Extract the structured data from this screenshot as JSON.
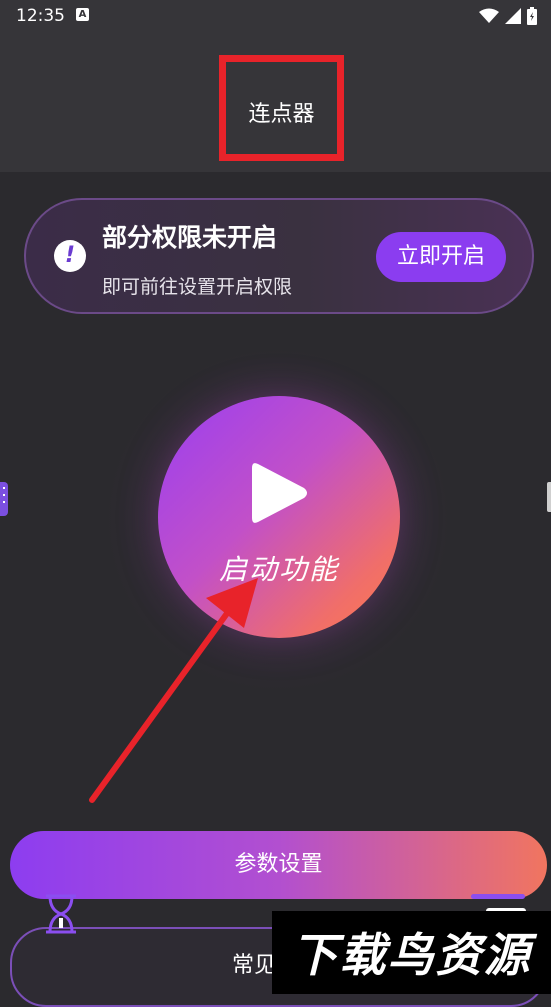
{
  "status_bar": {
    "time": "12:35",
    "badge": "A",
    "icons": [
      "wifi-icon",
      "signal-icon",
      "battery-icon"
    ]
  },
  "header": {
    "title": "连点器"
  },
  "permission_card": {
    "title": "部分权限未开启",
    "subtitle": "即可前往设置开启权限",
    "button_label": "立即开启",
    "icon": "exclamation-icon"
  },
  "start": {
    "label": "启动功能",
    "icon": "play-icon"
  },
  "bottom": {
    "params_label": "参数设置",
    "faq_label": "常见"
  },
  "watermark": {
    "text": "下载鸟资源"
  },
  "colors": {
    "background": "#2b2a2e",
    "header": "#363539",
    "accent_purple": "#8b3df0",
    "accent_orange": "#ff7b4a",
    "annotation_red": "#e8232a"
  }
}
